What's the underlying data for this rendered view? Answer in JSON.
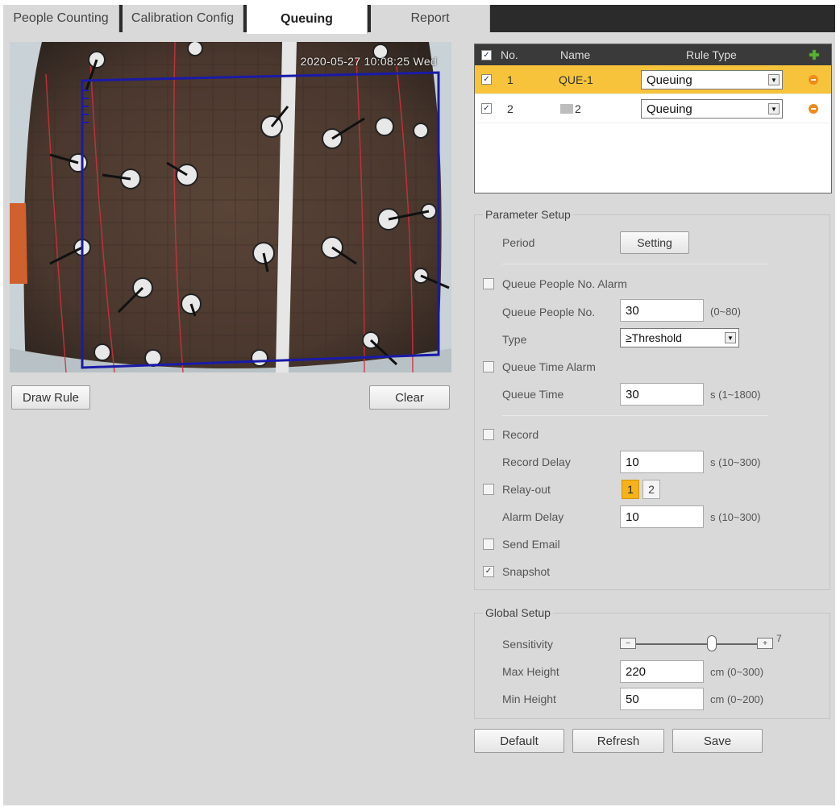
{
  "tabs": [
    {
      "label": "People Counting"
    },
    {
      "label": "Calibration Config"
    },
    {
      "label": "Queuing"
    },
    {
      "label": "Report"
    }
  ],
  "video": {
    "timestamp": "2020-05-27 10:08:25 Wed"
  },
  "buttons": {
    "draw_rule": "Draw Rule",
    "clear": "Clear",
    "default": "Default",
    "refresh": "Refresh",
    "save": "Save"
  },
  "rules": {
    "headers": {
      "no": "No.",
      "name": "Name",
      "rule_type": "Rule Type"
    },
    "rows": [
      {
        "no": "1",
        "name": "QUE-1",
        "type": "Queuing",
        "checked": true,
        "selected": true
      },
      {
        "no": "2",
        "name": "2",
        "type": "Queuing",
        "checked": true,
        "selected": false
      }
    ]
  },
  "parameter_setup": {
    "legend": "Parameter Setup",
    "period_label": "Period",
    "setting_button": "Setting",
    "queue_people_alarm": "Queue People No. Alarm",
    "queue_people_no_label": "Queue People No.",
    "queue_people_no_value": "30",
    "queue_people_no_hint": "(0~80)",
    "type_label": "Type",
    "type_value": "≥Threshold",
    "queue_time_alarm": "Queue Time Alarm",
    "queue_time_label": "Queue Time",
    "queue_time_value": "30",
    "queue_time_hint": "s (1~1800)",
    "record": "Record",
    "record_delay_label": "Record Delay",
    "record_delay_value": "10",
    "record_delay_hint": "s (10~300)",
    "relay_out": "Relay-out",
    "relay_1": "1",
    "relay_2": "2",
    "alarm_delay_label": "Alarm Delay",
    "alarm_delay_value": "10",
    "alarm_delay_hint": "s (10~300)",
    "send_email": "Send Email",
    "snapshot": "Snapshot",
    "snapshot_checked": true
  },
  "global_setup": {
    "legend": "Global Setup",
    "sensitivity_label": "Sensitivity",
    "sensitivity_value": "7",
    "max_height_label": "Max Height",
    "max_height_value": "220",
    "max_height_hint": "cm (0~300)",
    "min_height_label": "Min Height",
    "min_height_value": "50",
    "min_height_hint": "cm (0~200)"
  },
  "colors": {
    "selected_row": "#f6c33b",
    "rule_line": "#1a1aa8",
    "add_icon": "#5bb030",
    "remove_icon": "#f08a1c"
  }
}
